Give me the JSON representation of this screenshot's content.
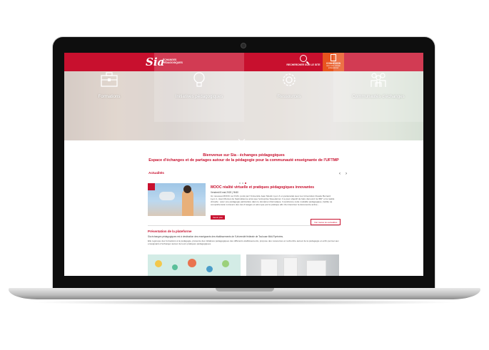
{
  "header": {
    "logo": "Sia",
    "logo_sub": "ÉCHANGES PÉDAGOGIQUES",
    "search_label": "RECHERCHER SUR LE SITE",
    "login_label": "CONNEXION",
    "login_sub": "avec votre compte professionnel"
  },
  "hero": {
    "items": [
      {
        "label": "Formations",
        "icon": "briefcase-icon"
      },
      {
        "label": "Initiatives pédagogiques",
        "icon": "bulb-icon"
      },
      {
        "label": "Ressources",
        "icon": "gear-icon"
      },
      {
        "label": "Communautés d'échanges",
        "icon": "people-icon"
      }
    ]
  },
  "welcome": {
    "line1": "Bienvenue sur Sia - échanges pédagogiques",
    "line2": "Espace d'échanges et de partages autour de la pédagogie pour la communauté enseignante de l'UFTMP"
  },
  "news": {
    "section_title": "Actualités",
    "prev": "‹",
    "next": "›",
    "article_title": "MOOC réalité virtuelle et pratiques pédagogiques innovantes",
    "article_meta": "Vendredi 8 mai 2020 | 9h30",
    "article_body": "Un nouveau MOOC sur FUN, porté par l'Université Jean Moulin Lyon 3 en partenariat avec les Universités Claude Bernard Lyon 1, Jean Monnet de Saint-Etienne ainsi que l'entreprise Speedernet. Il a pour objectif de faire découvrir la 360° et la réalité virtuelle : avec une pédagogie particulière dans le domaine informatique. Il positionne cette modalité pédagogique, facilite sa compréhension à travers des cas d'usages et ainsi que par la pratique afin d'en favoriser la découverte active...",
    "read_more": "Savoir plus",
    "all_news": "Voir toutes les actualités"
  },
  "presentation": {
    "title": "Présentation de la plateforme",
    "p1": "Sia échanges pédagogiques est à destination des enseignants des établissements de l'Université fédérale de Toulouse Midi-Pyrénées.",
    "p2": "Elle regroupe des formations à la pédagogie, présente des initiatives pédagogiques des différents établissements, propose des ressources et recherche autour de la pédagogie et enfin permet aux enseignants d'échanger autour de leurs pratiques pédagogiques."
  },
  "colors": {
    "brand_red": "#c8102e",
    "login_orange": "#e8541e"
  }
}
